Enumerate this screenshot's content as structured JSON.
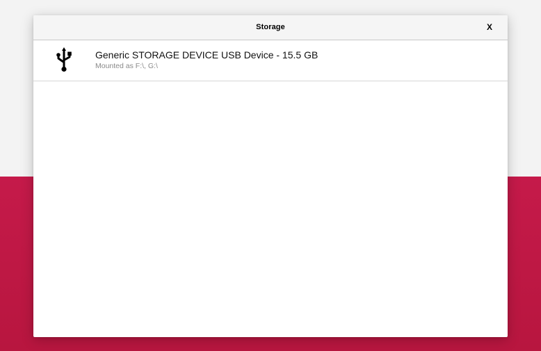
{
  "dialog": {
    "title": "Storage",
    "close_label": "X"
  },
  "devices": [
    {
      "icon": "usb-icon",
      "name": "Generic STORAGE DEVICE USB Device - 15.5 GB",
      "mount": "Mounted as F:\\, G:\\"
    }
  ],
  "colors": {
    "backdrop": "#f3f3f3",
    "accent_band": "#c51a4a",
    "dialog_bg": "#ffffff",
    "header_bg": "#f5f5f5",
    "secondary_text": "#8a8a8a"
  }
}
